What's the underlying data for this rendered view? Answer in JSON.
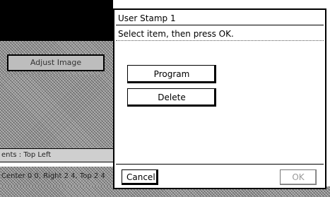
{
  "background_screen": {
    "adjust_image_label": "Adjust Image",
    "status_line_1": "ents : Top Left",
    "status_line_2": "Center 0 0, Right 2 4, Top 2 4"
  },
  "dialog": {
    "title": "User Stamp 1",
    "instruction": "Select item, then press OK.",
    "options": {
      "program_label": "Program",
      "delete_label": "Delete"
    },
    "footer": {
      "cancel_label": "Cancel",
      "ok_label": "OK"
    }
  }
}
